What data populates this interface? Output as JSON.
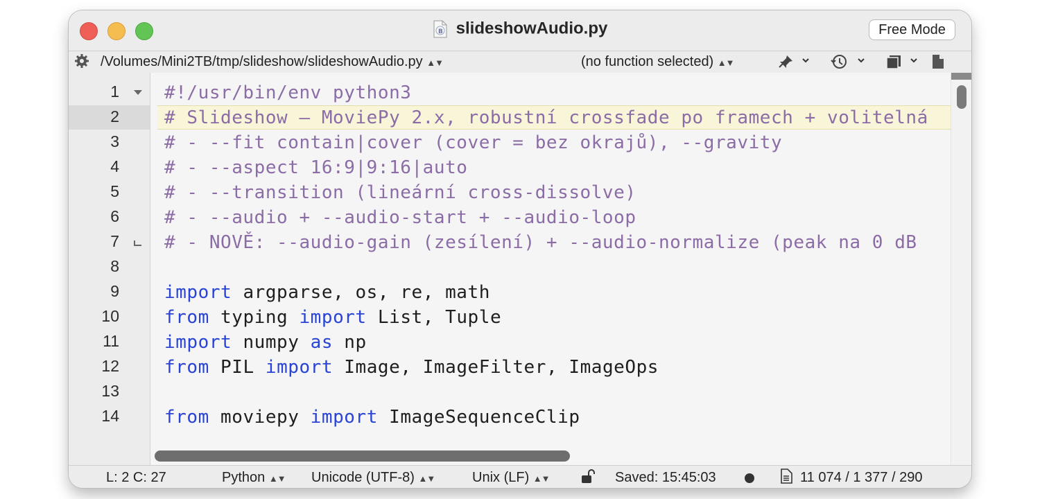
{
  "window": {
    "title": "slideshowAudio.py",
    "mode_button": "Free Mode"
  },
  "navbar": {
    "path": "/Volumes/Mini2TB/tmp/slideshow/slideshowAudio.py",
    "function_selector": "(no function selected)",
    "icons": [
      "gear-icon",
      "pin-icon",
      "history-icon",
      "window-icon",
      "document-icon"
    ]
  },
  "editor": {
    "current_line": 2,
    "line_numbers": [
      "1",
      "2",
      "3",
      "4",
      "5",
      "6",
      "7",
      "8",
      "9",
      "10",
      "11",
      "12",
      "13",
      "14"
    ],
    "lines": [
      {
        "num": "1",
        "tokens": [
          {
            "t": "#!/usr/bin/env python3",
            "c": "cmt"
          }
        ]
      },
      {
        "num": "2",
        "tokens": [
          {
            "t": "# Slideshow – MoviePy 2.x, robustní crossfade po framech + volitelná",
            "c": "cmt"
          }
        ]
      },
      {
        "num": "3",
        "tokens": [
          {
            "t": "# - --fit contain|cover (cover = bez okrajů), --gravity",
            "c": "cmt"
          }
        ]
      },
      {
        "num": "4",
        "tokens": [
          {
            "t": "# - --aspect 16:9|9:16|auto",
            "c": "cmt"
          }
        ]
      },
      {
        "num": "5",
        "tokens": [
          {
            "t": "# - --transition (lineární cross-dissolve)",
            "c": "cmt"
          }
        ]
      },
      {
        "num": "6",
        "tokens": [
          {
            "t": "# - --audio + --audio-start + --audio-loop",
            "c": "cmt"
          }
        ]
      },
      {
        "num": "7",
        "tokens": [
          {
            "t": "# - NOVĚ: --audio-gain (zesílení) + --audio-normalize (peak na 0 dB",
            "c": "cmt"
          }
        ]
      },
      {
        "num": "8",
        "tokens": []
      },
      {
        "num": "9",
        "tokens": [
          {
            "t": "import",
            "c": "kw"
          },
          {
            "t": " argparse, os, re, math",
            "c": ""
          }
        ]
      },
      {
        "num": "10",
        "tokens": [
          {
            "t": "from",
            "c": "kw"
          },
          {
            "t": " typing ",
            "c": ""
          },
          {
            "t": "import",
            "c": "kw"
          },
          {
            "t": " List, Tuple",
            "c": ""
          }
        ]
      },
      {
        "num": "11",
        "tokens": [
          {
            "t": "import",
            "c": "kw"
          },
          {
            "t": " numpy ",
            "c": ""
          },
          {
            "t": "as",
            "c": "kw"
          },
          {
            "t": " np",
            "c": ""
          }
        ]
      },
      {
        "num": "12",
        "tokens": [
          {
            "t": "from",
            "c": "kw"
          },
          {
            "t": " PIL ",
            "c": ""
          },
          {
            "t": "import",
            "c": "kw"
          },
          {
            "t": " Image, ImageFilter, ImageOps",
            "c": ""
          }
        ]
      },
      {
        "num": "13",
        "tokens": []
      },
      {
        "num": "14",
        "tokens": [
          {
            "t": "from",
            "c": "kw"
          },
          {
            "t": " moviepy ",
            "c": ""
          },
          {
            "t": "import",
            "c": "kw"
          },
          {
            "t": " ImageSequenceClip",
            "c": ""
          }
        ]
      }
    ],
    "colors": {
      "comment": "#8b6ca6",
      "keyword": "#2843d6",
      "current_line": "#f8f5d8"
    }
  },
  "statusbar": {
    "cursor": "L: 2 C: 27",
    "language": "Python",
    "encoding": "Unicode (UTF-8)",
    "line_endings": "Unix (LF)",
    "saved": "Saved: 15:45:03",
    "counts": "11 074 / 1 377 / 290"
  },
  "colors": {
    "close": "#ee5f57",
    "minimize": "#f5bd4f",
    "zoom": "#61c454"
  }
}
